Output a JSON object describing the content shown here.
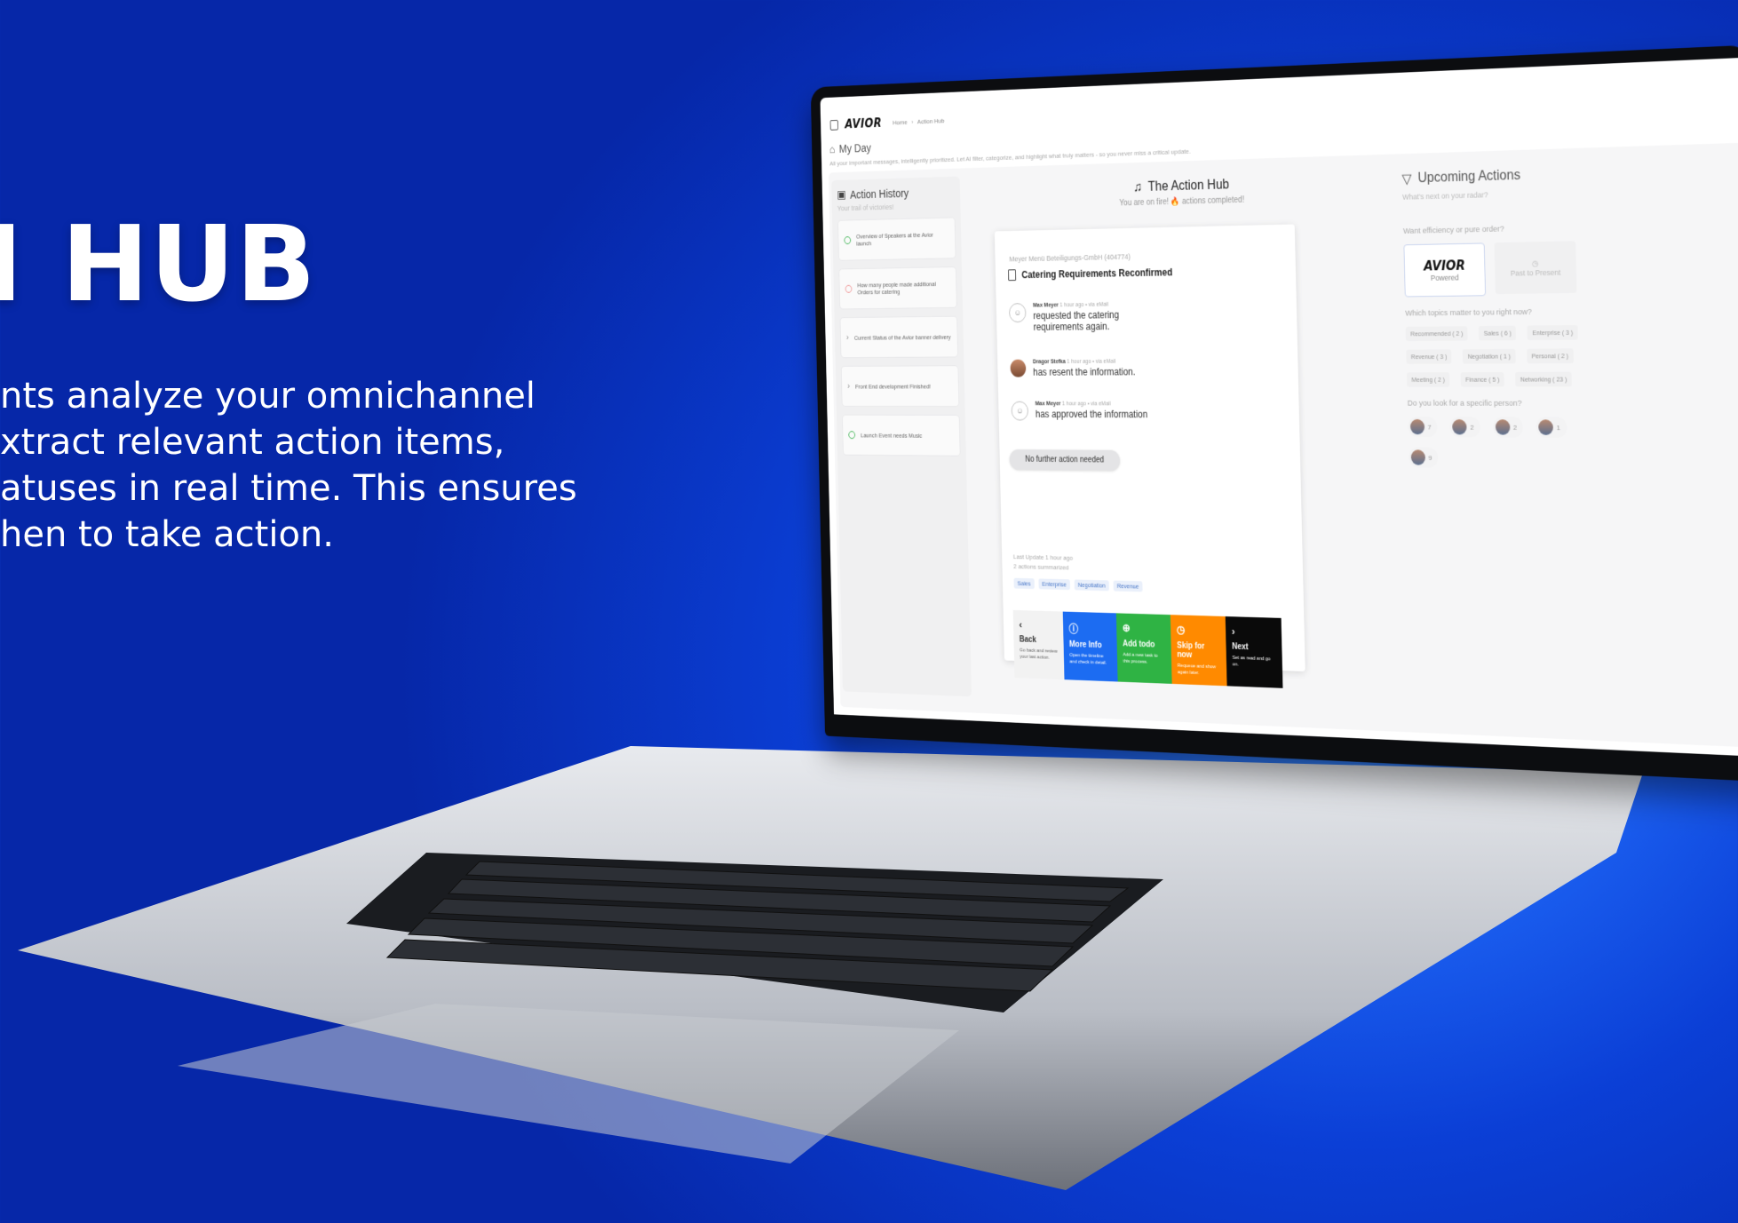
{
  "hero": {
    "title": "I HUB",
    "lines": [
      "nts analyze your omnichannel",
      "xtract relevant action items,",
      "atuses in real time. This ensures",
      "hen to take action."
    ]
  },
  "app": {
    "logo": "AVIOR",
    "breadcrumb": [
      "Home",
      "Action Hub"
    ],
    "page_title": "My Day",
    "page_subtitle": "All your important messages, intelligently prioritized. Let AI filter, categorize, and highlight what truly matters - so you never miss a critical update."
  },
  "history": {
    "title": "Action History",
    "subtitle": "Your trail of victories!",
    "items": [
      {
        "label": "Overview of Speakers at the Avior launch",
        "status": "done"
      },
      {
        "label": "How many people made additional Orders for catering",
        "status": "alert"
      },
      {
        "label": "Current Status of the Avior banner delivery",
        "status": "pending"
      },
      {
        "label": "Front End development Finished!",
        "status": "pending"
      },
      {
        "label": "Launch Event needs Music",
        "status": "done"
      }
    ]
  },
  "hub": {
    "title": "The Action Hub",
    "subtitle": "You are on fire! 🔥 actions completed!",
    "card": {
      "company": "Meyer Menü Beteiligungs-GmbH (404774)",
      "title": "Catering Requirements Reconfirmed",
      "timeline": [
        {
          "name": "Max Meyer",
          "meta": "1 hour ago • via eMail",
          "text": "requested the catering requirements again."
        },
        {
          "name": "Dragor Stefka",
          "meta": "1 hour ago • via eMail",
          "text": "has resent the information."
        },
        {
          "name": "Max Meyer",
          "meta": "1 hour ago • via eMail",
          "text": "has approved the information"
        }
      ],
      "status_pill": "No further action needed",
      "last_update": "Last Update 1 hour ago",
      "summary": "2 actions summarized",
      "tags": [
        "Sales",
        "Enterprise",
        "Negotiation",
        "Revenue"
      ]
    },
    "actions": [
      {
        "label": "Back",
        "desc": "Go back and review your last action."
      },
      {
        "label": "More Info",
        "desc": "Open the timeline and check in detail."
      },
      {
        "label": "Add todo",
        "desc": "Add a new task to this process."
      },
      {
        "label": "Skip for now",
        "desc": "Requeue and show again later."
      },
      {
        "label": "Next",
        "desc": "Set as read and go on."
      }
    ]
  },
  "upcoming": {
    "title": "Upcoming Actions",
    "subtitle": "What's next on your radar?",
    "q_mode": "Want efficiency or pure order?",
    "mode_selected_logo": "AVIOR",
    "mode_selected_caption": "Powered",
    "mode_other": "Past to Present",
    "q_topics": "Which topics matter to you right now?",
    "topics": [
      "Recommended ( 2 )",
      "Sales ( 6 )",
      "Enterprise ( 3 )",
      "Revenue ( 3 )",
      "Negotiation ( 1 )",
      "Personal ( 2 )",
      "Meeting ( 2 )",
      "Finance ( 5 )",
      "Networking ( 23 )"
    ],
    "q_people": "Do you look for a specific person?",
    "people": [
      "7",
      "2",
      "2",
      "1",
      "9"
    ]
  },
  "colors": {
    "bg_blue": "#0b3fd6",
    "more_info": "#1c6cf2",
    "add_todo": "#2fb344",
    "skip": "#ff8a00",
    "next": "#0a0a0a"
  }
}
